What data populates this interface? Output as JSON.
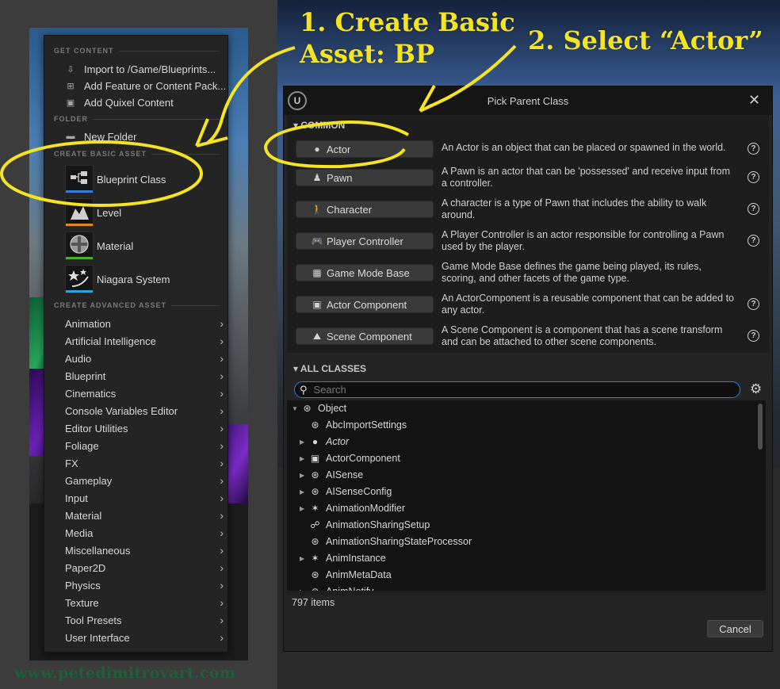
{
  "context_menu": {
    "get_content_header": "GET CONTENT",
    "get_content_items": [
      {
        "label": "Import to /Game/Blueprints...",
        "icon": "import-icon"
      },
      {
        "label": "Add Feature or Content Pack...",
        "icon": "add-pack-icon"
      },
      {
        "label": "Add Quixel Content",
        "icon": "quixel-icon"
      }
    ],
    "folder_header": "FOLDER",
    "new_folder": "New Folder",
    "create_basic_header": "CREATE BASIC ASSET",
    "basic_assets": [
      {
        "label": "Blueprint Class",
        "icon": "blueprint-class-icon",
        "color": "#3a7bd5"
      },
      {
        "label": "Level",
        "icon": "level-icon",
        "color": "#e08a1e"
      },
      {
        "label": "Material",
        "icon": "material-icon",
        "color": "#4caf2f"
      },
      {
        "label": "Niagara System",
        "icon": "niagara-system-icon",
        "color": "#2aa3d8"
      }
    ],
    "create_advanced_header": "CREATE ADVANCED ASSET",
    "advanced_assets": [
      "Animation",
      "Artificial Intelligence",
      "Audio",
      "Blueprint",
      "Cinematics",
      "Console Variables Editor",
      "Editor Utilities",
      "Foliage",
      "FX",
      "Gameplay",
      "Input",
      "Material",
      "Media",
      "Miscellaneous",
      "Paper2D",
      "Physics",
      "Texture",
      "Tool Presets",
      "User Interface"
    ]
  },
  "dialog": {
    "logo": "U",
    "title": "Pick Parent Class",
    "common_header": "COMMON",
    "common_classes": [
      {
        "label": "Actor",
        "icon": "actor-icon",
        "desc": "An Actor is an object that can be placed or spawned in the world.",
        "help": true
      },
      {
        "label": "Pawn",
        "icon": "pawn-icon",
        "desc": "A Pawn is an actor that can be 'possessed' and receive input from a controller.",
        "help": true
      },
      {
        "label": "Character",
        "icon": "character-icon",
        "desc": "A character is a type of Pawn that includes the ability to walk around.",
        "help": true
      },
      {
        "label": "Player Controller",
        "icon": "gamepad-icon",
        "desc": "A Player Controller is an actor responsible for controlling a Pawn used by the player.",
        "help": true
      },
      {
        "label": "Game Mode Base",
        "icon": "game-mode-icon",
        "desc": "Game Mode Base defines the game being played, its rules, scoring, and other facets of the game type.",
        "help": false
      },
      {
        "label": "Actor Component",
        "icon": "actor-component-icon",
        "desc": "An ActorComponent is a reusable component that can be added to any actor.",
        "help": true
      },
      {
        "label": "Scene Component",
        "icon": "scene-component-icon",
        "desc": "A Scene Component is a component that has a scene transform and can be attached to other scene components.",
        "help": true
      }
    ],
    "all_classes_header": "ALL CLASSES",
    "search_placeholder": "Search",
    "tree": [
      {
        "label": "Object",
        "level": 0,
        "arrow": "open",
        "icon": "object-icon"
      },
      {
        "label": "AbcImportSettings",
        "level": 1,
        "arrow": "none",
        "icon": "object-icon"
      },
      {
        "label": "Actor",
        "level": 1,
        "arrow": "closed",
        "icon": "actor-icon",
        "italic": true
      },
      {
        "label": "ActorComponent",
        "level": 1,
        "arrow": "closed",
        "icon": "actor-component-icon"
      },
      {
        "label": "AISense",
        "level": 1,
        "arrow": "closed",
        "icon": "object-icon"
      },
      {
        "label": "AISenseConfig",
        "level": 1,
        "arrow": "closed",
        "icon": "object-icon"
      },
      {
        "label": "AnimationModifier",
        "level": 1,
        "arrow": "closed",
        "icon": "animation-icon"
      },
      {
        "label": "AnimationSharingSetup",
        "level": 1,
        "arrow": "none",
        "icon": "skeleton-icon"
      },
      {
        "label": "AnimationSharingStateProcessor",
        "level": 1,
        "arrow": "none",
        "icon": "object-icon"
      },
      {
        "label": "AnimInstance",
        "level": 1,
        "arrow": "closed",
        "icon": "animation-icon"
      },
      {
        "label": "AnimMetaData",
        "level": 1,
        "arrow": "none",
        "icon": "object-icon"
      },
      {
        "label": "AnimNotify",
        "level": 1,
        "arrow": "closed",
        "icon": "object-icon"
      }
    ],
    "items_count": "797 items",
    "cancel_label": "Cancel"
  },
  "annotations": {
    "step1_line1": "1. Create Basic",
    "step1_line2": "Asset: BP",
    "step2": "2. Select “Actor”",
    "color": "#f4e423"
  },
  "watermark": "www.petedimitrovart.com"
}
